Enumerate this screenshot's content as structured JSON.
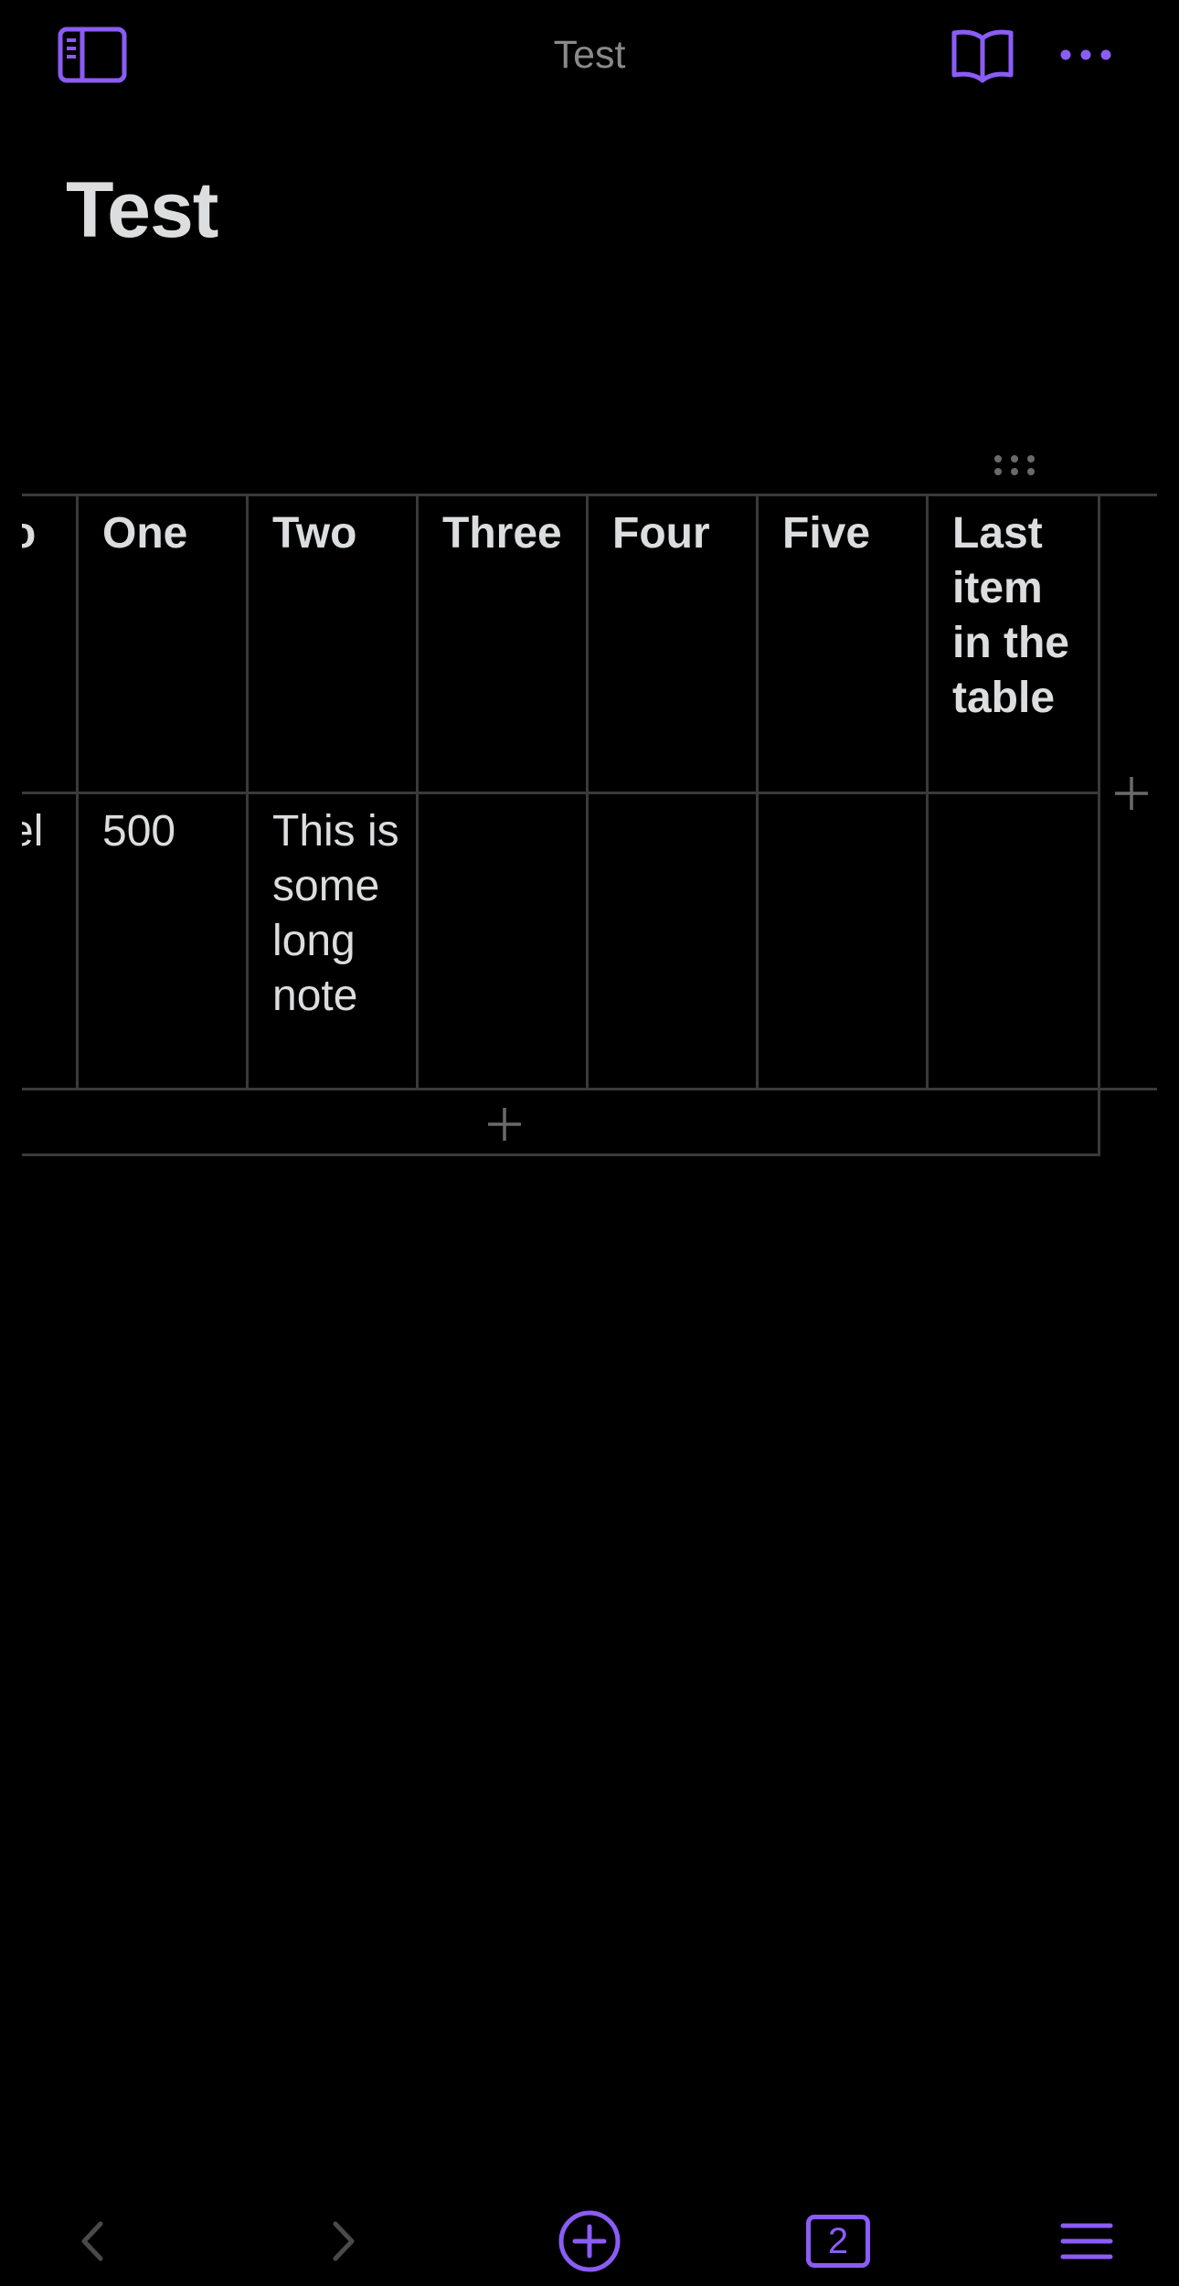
{
  "header": {
    "title": "Test"
  },
  "note": {
    "title": "Test"
  },
  "table": {
    "partial_first_column": {
      "header": "o",
      "cell": "el"
    },
    "headers": [
      "One",
      "Two",
      "Three",
      "Four",
      "Five",
      "Last item in the table"
    ],
    "rows": [
      [
        "500",
        "This is some long note",
        "",
        "",
        "",
        ""
      ]
    ]
  },
  "toolbar": {
    "open_tabs": "2"
  },
  "icons": {
    "sidebar": "sidebar-toggle-icon",
    "reading": "book-open-icon",
    "more": "ellipsis-icon",
    "table_handle": "drag-handle-icon",
    "add_column": "plus-icon",
    "add_row": "plus-icon",
    "back": "chevron-left-icon",
    "forward": "chevron-right-icon",
    "new_note": "plus-circle-icon",
    "tabs": "tabs-icon",
    "menu": "hamburger-icon"
  },
  "colors": {
    "accent": "#8b5cf6",
    "background": "#000000",
    "text": "#dcddde",
    "muted": "#8a8a8a",
    "border": "#3a3a3a",
    "disabled": "#4a4a4a"
  }
}
